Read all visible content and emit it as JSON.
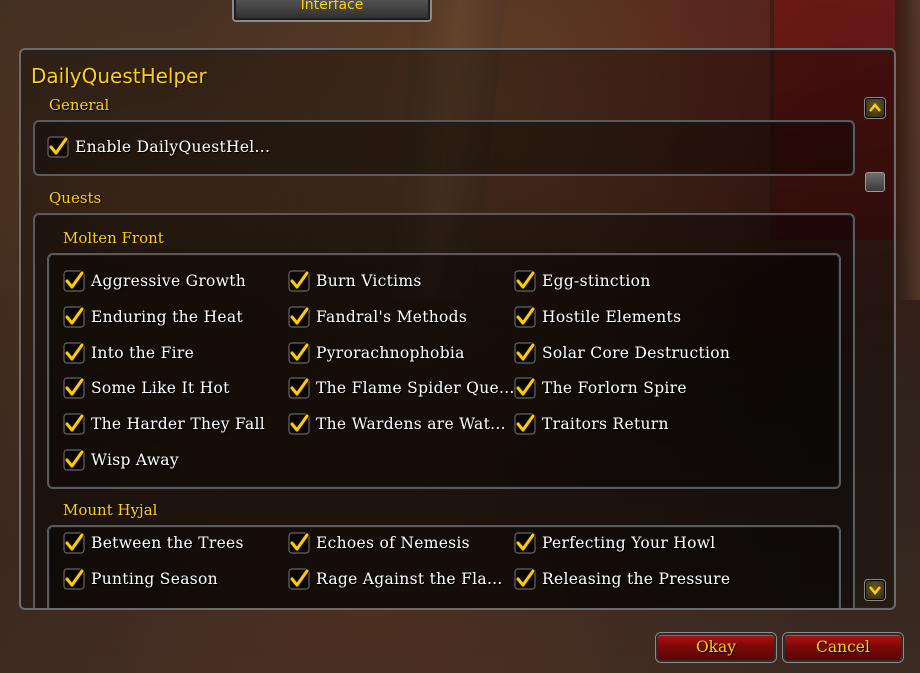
{
  "window": {
    "tab_label": "Interface",
    "addon_title": "DailyQuestHelper"
  },
  "sections": {
    "general": "General",
    "quests": "Quests",
    "molten_front": "Molten Front",
    "mount_hyjal": "Mount Hyjal"
  },
  "general_options": [
    {
      "label": "Enable DailyQuestHel...",
      "checked": true
    }
  ],
  "molten_front_quests": [
    "Aggressive Growth",
    "Burn Victims",
    "Egg-stinction",
    "Enduring the Heat",
    "Fandral's Methods",
    "Hostile Elements",
    "Into the Fire",
    "Pyrorachnophobia",
    "Solar Core Destruction",
    "Some Like It Hot",
    "The Flame Spider Que...",
    "The Forlorn Spire",
    "The Harder They Fall",
    "The Wardens are Wat...",
    "Traitors Return",
    "Wisp Away"
  ],
  "mount_hyjal_quests": [
    "Between the Trees",
    "Echoes of Nemesis",
    "Perfecting Your Howl",
    "Punting Season",
    "Rage Against the Fla...",
    "Releasing the Pressure"
  ],
  "buttons": {
    "okay": "Okay",
    "cancel": "Cancel"
  },
  "colors": {
    "title_gold": "#ffd100",
    "check_gold": "#ffcc00",
    "button_red": "#8a0a0a"
  }
}
